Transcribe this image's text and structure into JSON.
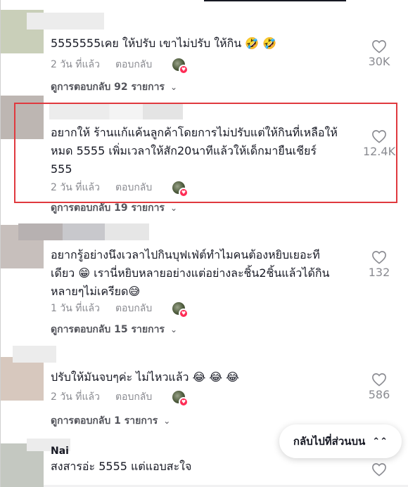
{
  "comments": [
    {
      "text_lines": [
        "5555555เคย ให้ปรับ เขาไม่ปรับ ให้กิน"
      ],
      "emoji": "🤣 🤣",
      "time": "2 วัน ที่แล้ว",
      "reply_label": "ตอบกลับ",
      "likes": "30K",
      "view_replies": "ดูการตอบกลับ 92 รายการ"
    },
    {
      "text_lines": [
        "อยากให้ ร้านแก้แค้นลูกค้าโดยการไม่ปรับแต่ให้กินที่เหลือให้",
        "หมด 5555 เพิ่มเวลาให้สัก20นาทีแล้วให้เด็กมายืนเชียร์",
        "555"
      ],
      "time": "2 วัน ที่แล้ว",
      "reply_label": "ตอบกลับ",
      "likes": "12.4K",
      "view_replies": "ดูการตอบกลับ 19 รายการ"
    },
    {
      "text_lines": [
        "อยากรู้อย่างนึงเวลาไปกินบุฟเฟ่ต์ทำไมคนต้องหยิบเยอะที",
        "เดียว",
        "เรานี่หยิบหลายอย่างแต่อย่างละชิ้น2ชิ้นแล้วได้กิน",
        "หลายๆไม่เครียด"
      ],
      "emoji_a": "😁",
      "emoji_b": "😅",
      "time": "1 วัน ที่แล้ว",
      "reply_label": "ตอบกลับ",
      "likes": "132",
      "view_replies": "ดูการตอบกลับ 15 รายการ"
    },
    {
      "text_lines": [
        "ปรับให้มันจบๆค่ะ ไม่ไหวแล้ว"
      ],
      "emoji": "😂 😂 😂",
      "time": "2 วัน ที่แล้ว",
      "reply_label": "ตอบกลับ",
      "likes": "586",
      "view_replies": "ดูการตอบกลับ 1 รายการ"
    },
    {
      "username": "Nai",
      "text_lines": [
        "สงสารอ่ะ 5555 แต่แอบสะใจ"
      ]
    }
  ],
  "back_to_top": "กลับไปที่ส่วนบน",
  "icons": {
    "heart": "heart-outline-icon",
    "chevron": "chevron-down-icon",
    "back_to_top_arrow": "double-chevron-up-icon"
  },
  "colors": {
    "highlight": "#e0393e",
    "muted": "#8a8b91",
    "text": "#161823",
    "badge": "#fe2c55"
  }
}
